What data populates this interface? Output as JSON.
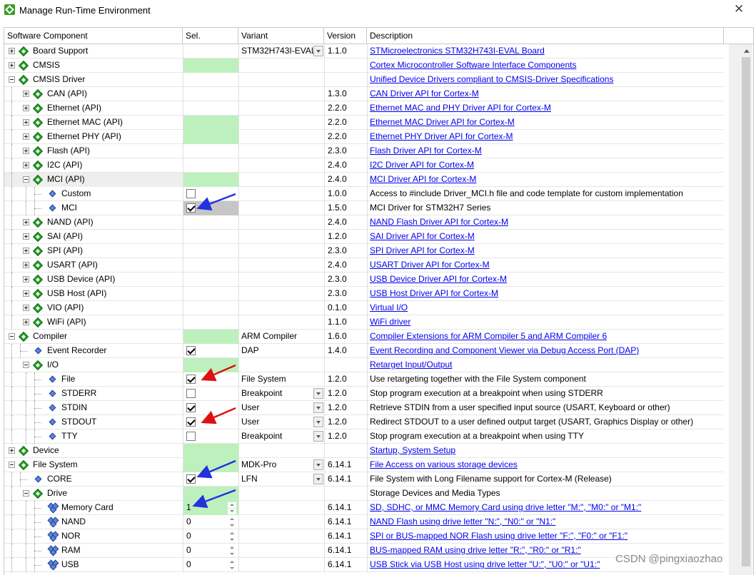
{
  "window": {
    "title": "Manage Run-Time Environment",
    "close": "✕"
  },
  "columns": {
    "component": "Software Component",
    "sel": "Sel.",
    "variant": "Variant",
    "version": "Version",
    "description": "Description"
  },
  "rows": [
    {
      "label": "Board Support",
      "depth": 0,
      "icon": "green",
      "exp": "plus",
      "sel": "",
      "variant": "STM32H743I-EVAL",
      "variant_dd": true,
      "version": "1.1.0",
      "desc": "STMicroelectronics STM32H743I-EVAL Board",
      "link": true
    },
    {
      "label": "CMSIS",
      "depth": 0,
      "icon": "green",
      "exp": "plus",
      "sel": "green",
      "variant": "",
      "version": "",
      "desc": "Cortex Microcontroller Software Interface Components",
      "link": true
    },
    {
      "label": "CMSIS Driver",
      "depth": 0,
      "icon": "green",
      "exp": "minus",
      "sel": "",
      "variant": "",
      "version": "",
      "desc": "Unified Device Drivers compliant to CMSIS-Driver Specifications",
      "link": true
    },
    {
      "label": "CAN (API)",
      "depth": 1,
      "icon": "green",
      "exp": "plus",
      "sel": "",
      "variant": "",
      "version": "1.3.0",
      "desc": "CAN Driver API for Cortex-M",
      "link": true
    },
    {
      "label": "Ethernet (API)",
      "depth": 1,
      "icon": "green",
      "exp": "plus",
      "sel": "",
      "variant": "",
      "version": "2.2.0",
      "desc": "Ethernet MAC and PHY Driver API for Cortex-M",
      "link": true
    },
    {
      "label": "Ethernet MAC (API)",
      "depth": 1,
      "icon": "green",
      "exp": "plus",
      "sel": "green",
      "variant": "",
      "version": "2.2.0",
      "desc": "Ethernet MAC Driver API for Cortex-M",
      "link": true
    },
    {
      "label": "Ethernet PHY (API)",
      "depth": 1,
      "icon": "green",
      "exp": "plus",
      "sel": "green",
      "variant": "",
      "version": "2.2.0",
      "desc": "Ethernet PHY Driver API for Cortex-M",
      "link": true
    },
    {
      "label": "Flash (API)",
      "depth": 1,
      "icon": "green",
      "exp": "plus",
      "sel": "",
      "variant": "",
      "version": "2.3.0",
      "desc": "Flash Driver API for Cortex-M",
      "link": true
    },
    {
      "label": "I2C (API)",
      "depth": 1,
      "icon": "green",
      "exp": "plus",
      "sel": "",
      "variant": "",
      "version": "2.4.0",
      "desc": "I2C Driver API for Cortex-M",
      "link": true
    },
    {
      "label": "MCI (API)",
      "depth": 1,
      "icon": "green",
      "exp": "minus",
      "sel": "green",
      "variant": "",
      "version": "2.4.0",
      "desc": "MCI Driver API for Cortex-M",
      "link": true,
      "hl": true
    },
    {
      "label": "Custom",
      "depth": 2,
      "icon": "blue",
      "sel": "cb-off",
      "variant": "",
      "version": "1.0.0",
      "desc": "Access to #include Driver_MCI.h file and code template for custom implementation",
      "link": false
    },
    {
      "label": "MCI",
      "depth": 2,
      "icon": "blue",
      "sel": "cb-on-gray",
      "variant": "",
      "version": "1.5.0",
      "desc": "MCI Driver for STM32H7 Series",
      "link": false
    },
    {
      "label": "NAND (API)",
      "depth": 1,
      "icon": "green",
      "exp": "plus",
      "sel": "",
      "variant": "",
      "version": "2.4.0",
      "desc": "NAND Flash Driver API for Cortex-M",
      "link": true
    },
    {
      "label": "SAI (API)",
      "depth": 1,
      "icon": "green",
      "exp": "plus",
      "sel": "",
      "variant": "",
      "version": "1.2.0",
      "desc": "SAI Driver API for Cortex-M",
      "link": true
    },
    {
      "label": "SPI (API)",
      "depth": 1,
      "icon": "green",
      "exp": "plus",
      "sel": "",
      "variant": "",
      "version": "2.3.0",
      "desc": "SPI Driver API for Cortex-M",
      "link": true
    },
    {
      "label": "USART (API)",
      "depth": 1,
      "icon": "green",
      "exp": "plus",
      "sel": "",
      "variant": "",
      "version": "2.4.0",
      "desc": "USART Driver API for Cortex-M",
      "link": true
    },
    {
      "label": "USB Device (API)",
      "depth": 1,
      "icon": "green",
      "exp": "plus",
      "sel": "",
      "variant": "",
      "version": "2.3.0",
      "desc": "USB Device Driver API for Cortex-M",
      "link": true
    },
    {
      "label": "USB Host (API)",
      "depth": 1,
      "icon": "green",
      "exp": "plus",
      "sel": "",
      "variant": "",
      "version": "2.3.0",
      "desc": "USB Host Driver API for Cortex-M",
      "link": true
    },
    {
      "label": "VIO (API)",
      "depth": 1,
      "icon": "green",
      "exp": "plus",
      "sel": "",
      "variant": "",
      "version": "0.1.0",
      "desc": "Virtual I/O",
      "link": true
    },
    {
      "label": "WiFi (API)",
      "depth": 1,
      "icon": "green",
      "exp": "plus",
      "sel": "",
      "variant": "",
      "version": "1.1.0",
      "desc": "WiFi driver",
      "link": true
    },
    {
      "label": "Compiler",
      "depth": 0,
      "icon": "green",
      "exp": "minus",
      "sel": "green",
      "variant": "ARM Compiler",
      "version": "1.6.0",
      "desc": "Compiler Extensions for ARM Compiler 5 and ARM Compiler 6",
      "link": true
    },
    {
      "label": "Event Recorder",
      "depth": 1,
      "icon": "blue",
      "sel": "cb-on",
      "variant": "DAP",
      "version": "1.4.0",
      "desc": "Event Recording and Component Viewer via Debug Access Port (DAP)",
      "link": true
    },
    {
      "label": "I/O",
      "depth": 1,
      "icon": "green",
      "exp": "minus",
      "sel": "green",
      "variant": "",
      "version": "",
      "desc": "Retarget Input/Output",
      "link": true
    },
    {
      "label": "File",
      "depth": 2,
      "icon": "blue",
      "sel": "cb-on",
      "variant": "File System",
      "version": "1.2.0",
      "desc": "Use retargeting together with the File System component",
      "link": false
    },
    {
      "label": "STDERR",
      "depth": 2,
      "icon": "blue",
      "sel": "cb-off",
      "variant": "Breakpoint",
      "variant_dd": true,
      "version": "1.2.0",
      "desc": "Stop program execution at a breakpoint when using STDERR",
      "link": false
    },
    {
      "label": "STDIN",
      "depth": 2,
      "icon": "blue",
      "sel": "cb-on",
      "variant": "User",
      "variant_dd": true,
      "version": "1.2.0",
      "desc": "Retrieve STDIN from a user specified input source  (USART, Keyboard or other)",
      "link": false
    },
    {
      "label": "STDOUT",
      "depth": 2,
      "icon": "blue",
      "sel": "cb-on",
      "variant": "User",
      "variant_dd": true,
      "version": "1.2.0",
      "desc": "Redirect STDOUT to a user defined output target (USART, Graphics Display or other)",
      "link": false
    },
    {
      "label": "TTY",
      "depth": 2,
      "icon": "blue",
      "sel": "cb-off",
      "variant": "Breakpoint",
      "variant_dd": true,
      "version": "1.2.0",
      "desc": "Stop program execution at a breakpoint when using TTY",
      "link": false
    },
    {
      "label": "Device",
      "depth": 0,
      "icon": "green",
      "exp": "plus",
      "sel": "green",
      "variant": "",
      "version": "",
      "desc": "Startup, System Setup",
      "link": true
    },
    {
      "label": "File System",
      "depth": 0,
      "icon": "green",
      "exp": "minus",
      "sel": "green",
      "variant": "MDK-Pro",
      "variant_dd": true,
      "version": "6.14.1",
      "desc": "File Access on various storage devices",
      "link": true
    },
    {
      "label": "CORE",
      "depth": 1,
      "icon": "blue",
      "sel": "cb-on",
      "variant": "LFN",
      "variant_dd": true,
      "version": "6.14.1",
      "desc": "File System with Long Filename support for Cortex-M (Release)",
      "link": false
    },
    {
      "label": "Drive",
      "depth": 1,
      "icon": "green",
      "exp": "minus",
      "sel": "green",
      "variant": "",
      "version": "",
      "desc": "Storage Devices and Media Types",
      "link": false
    },
    {
      "label": "Memory Card",
      "depth": 2,
      "icon": "multi",
      "sel": "num-green",
      "num": "1",
      "variant": "",
      "version": "6.14.1",
      "desc": "SD, SDHC, or MMC Memory Card using drive letter \"M:\", \"M0:\" or \"M1:\"",
      "link": true
    },
    {
      "label": "NAND",
      "depth": 2,
      "icon": "multi",
      "sel": "num",
      "num": "0",
      "variant": "",
      "version": "6.14.1",
      "desc": "NAND Flash using drive letter \"N:\", \"N0:\" or \"N1:\"",
      "link": true
    },
    {
      "label": "NOR",
      "depth": 2,
      "icon": "multi",
      "sel": "num",
      "num": "0",
      "variant": "",
      "version": "6.14.1",
      "desc": "SPI or BUS-mapped NOR Flash using drive letter \"F:\", \"F0:\" or \"F1:\"",
      "link": true
    },
    {
      "label": "RAM",
      "depth": 2,
      "icon": "multi",
      "sel": "num",
      "num": "0",
      "variant": "",
      "version": "6.14.1",
      "desc": "BUS-mapped RAM using drive letter \"R:\", \"R0:\" or \"R1:\"",
      "link": true
    },
    {
      "label": "USB",
      "depth": 2,
      "icon": "multi",
      "sel": "num",
      "num": "0",
      "variant": "",
      "version": "6.14.1",
      "desc": "USB Stick via USB Host using drive letter \"U:\", \"U0:\" or \"U1:\"",
      "link": true
    }
  ],
  "annotations": {
    "arrow_colors": {
      "blue": "#2233dd",
      "red": "#dd1111"
    }
  },
  "watermark": "CSDN @pingxiaozhao"
}
